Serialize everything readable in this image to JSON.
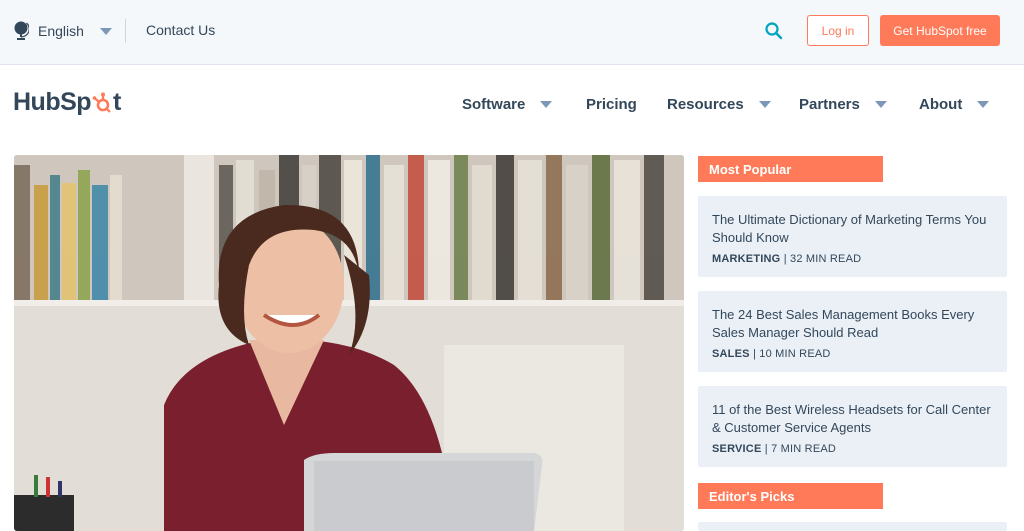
{
  "utility_bar": {
    "language_label": "English",
    "contact_label": "Contact Us",
    "login_label": "Log in",
    "cta_label": "Get HubSpot free"
  },
  "logo": {
    "text_start": "HubSp",
    "text_end": "t"
  },
  "nav": {
    "items": [
      {
        "label": "Software"
      },
      {
        "label": "Pricing"
      },
      {
        "label": "Resources"
      },
      {
        "label": "Partners"
      },
      {
        "label": "About"
      }
    ]
  },
  "sidebar": {
    "most_popular_label": "Most Popular",
    "editors_picks_label": "Editor's Picks",
    "cards": [
      {
        "title": "The Ultimate Dictionary of Marketing Terms You Should Know",
        "category": "MARKETING",
        "read_time": "| 32 MIN READ"
      },
      {
        "title": "The 24 Best Sales Management Books Every Sales Manager Should Read",
        "category": "SALES",
        "read_time": "| 10 MIN READ"
      },
      {
        "title": "11 of the Best Wireless Headsets for Call Center & Customer Service Agents",
        "category": "SERVICE",
        "read_time": "| 7 MIN READ"
      }
    ]
  },
  "colors": {
    "accent": "#ff7a59",
    "text": "#33475b",
    "card_bg": "#eaf0f6",
    "utility_bg": "#f5f8fa"
  },
  "icons": [
    "globe-icon",
    "chevron-down-icon",
    "search-icon",
    "sprocket-icon"
  ]
}
